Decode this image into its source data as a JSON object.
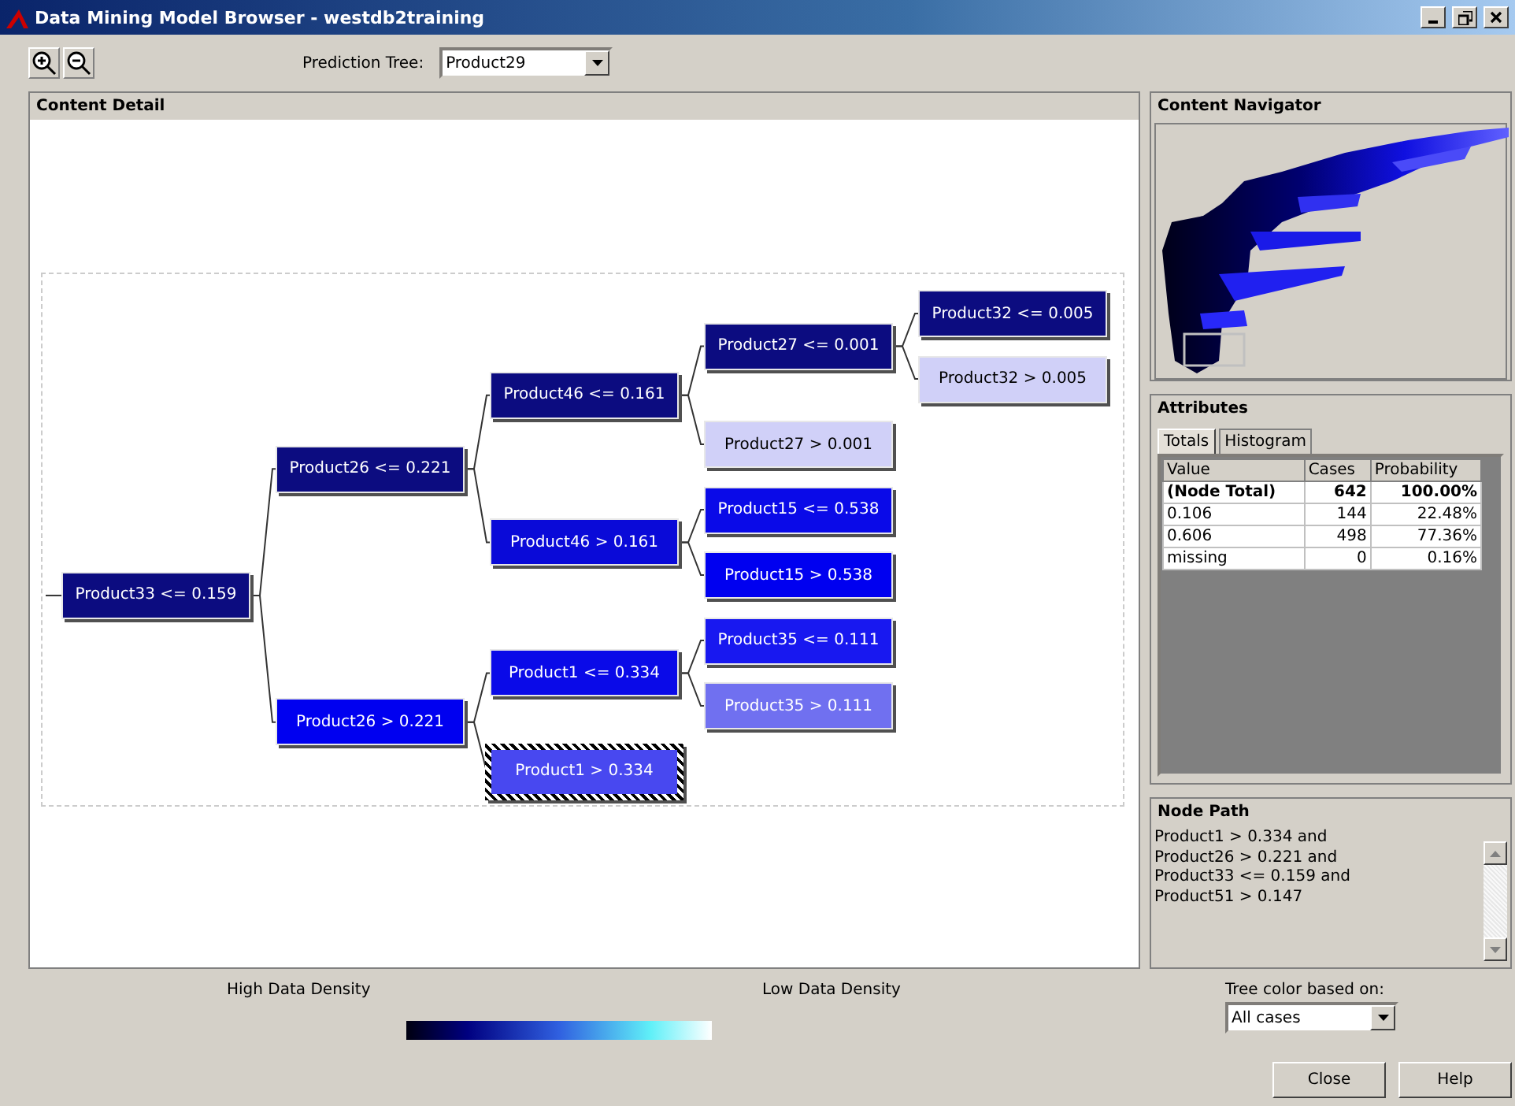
{
  "window": {
    "title": "Data Mining Model Browser - westdb2training"
  },
  "toolbar": {
    "prediction_tree_label": "Prediction Tree:",
    "prediction_tree_value": "Product29"
  },
  "content_detail": {
    "title": "Content Detail",
    "tree": {
      "label": "Product33 <= 0.159",
      "color": "#0c0c80",
      "selected": false,
      "children": [
        {
          "label": "Product26 <= 0.221",
          "color": "#0c0c80",
          "selected": false,
          "children": [
            {
              "label": "Product46 <= 0.161",
              "color": "#0c0c80",
              "selected": false,
              "children": [
                {
                  "label": "Product27 <= 0.001",
                  "color": "#0c0c80",
                  "selected": false,
                  "children": [
                    {
                      "label": "Product32 <= 0.005",
                      "color": "#0c0c80",
                      "selected": false
                    },
                    {
                      "label": "Product32 > 0.005",
                      "color": "#d0d0f8",
                      "selected": false
                    }
                  ]
                },
                {
                  "label": "Product27 > 0.001",
                  "color": "#d0d0f8",
                  "selected": false
                }
              ]
            },
            {
              "label": "Product46 > 0.161",
              "color": "#0a0ad8",
              "selected": false,
              "children": [
                {
                  "label": "Product15 <= 0.538",
                  "color": "#0a0ae8",
                  "selected": false
                },
                {
                  "label": "Product15 > 0.538",
                  "color": "#0000f0",
                  "selected": false
                }
              ]
            }
          ]
        },
        {
          "label": "Product26 > 0.221",
          "color": "#0000f0",
          "selected": false,
          "children": [
            {
              "label": "Product1 <= 0.334",
              "color": "#0a0ae8",
              "selected": false,
              "children": [
                {
                  "label": "Product35 <= 0.111",
                  "color": "#1818f0",
                  "selected": false
                },
                {
                  "label": "Product35 > 0.111",
                  "color": "#7070f0",
                  "selected": false
                }
              ]
            },
            {
              "label": "Product1 > 0.334",
              "color": "#4848f0",
              "selected": true
            }
          ]
        }
      ]
    }
  },
  "content_navigator": {
    "title": "Content Navigator"
  },
  "attributes": {
    "title": "Attributes",
    "tabs": [
      {
        "label": "Totals",
        "selected": true
      },
      {
        "label": "Histogram",
        "selected": false
      }
    ],
    "columns": [
      "Value",
      "Cases",
      "Probability"
    ],
    "rows": [
      {
        "kind": "total",
        "cells": [
          "(Node Total)",
          "642",
          "100.00%"
        ]
      },
      {
        "kind": "value",
        "cells": [
          "0.106",
          "144",
          "22.48%"
        ]
      },
      {
        "kind": "value",
        "cells": [
          "0.606",
          "498",
          "77.36%"
        ]
      },
      {
        "kind": "value",
        "cells": [
          "missing",
          "0",
          "0.16%"
        ]
      }
    ]
  },
  "node_path": {
    "title": "Node Path",
    "text": "Product1 > 0.334  and\nProduct26 > 0.221  and\nProduct33 <= 0.159  and\nProduct51 > 0.147"
  },
  "legend": {
    "high_label": "High Data Density",
    "low_label": "Low Data Density"
  },
  "tree_color": {
    "label": "Tree color based on:",
    "value": "All cases"
  },
  "buttons": [
    "Close",
    "Help"
  ]
}
